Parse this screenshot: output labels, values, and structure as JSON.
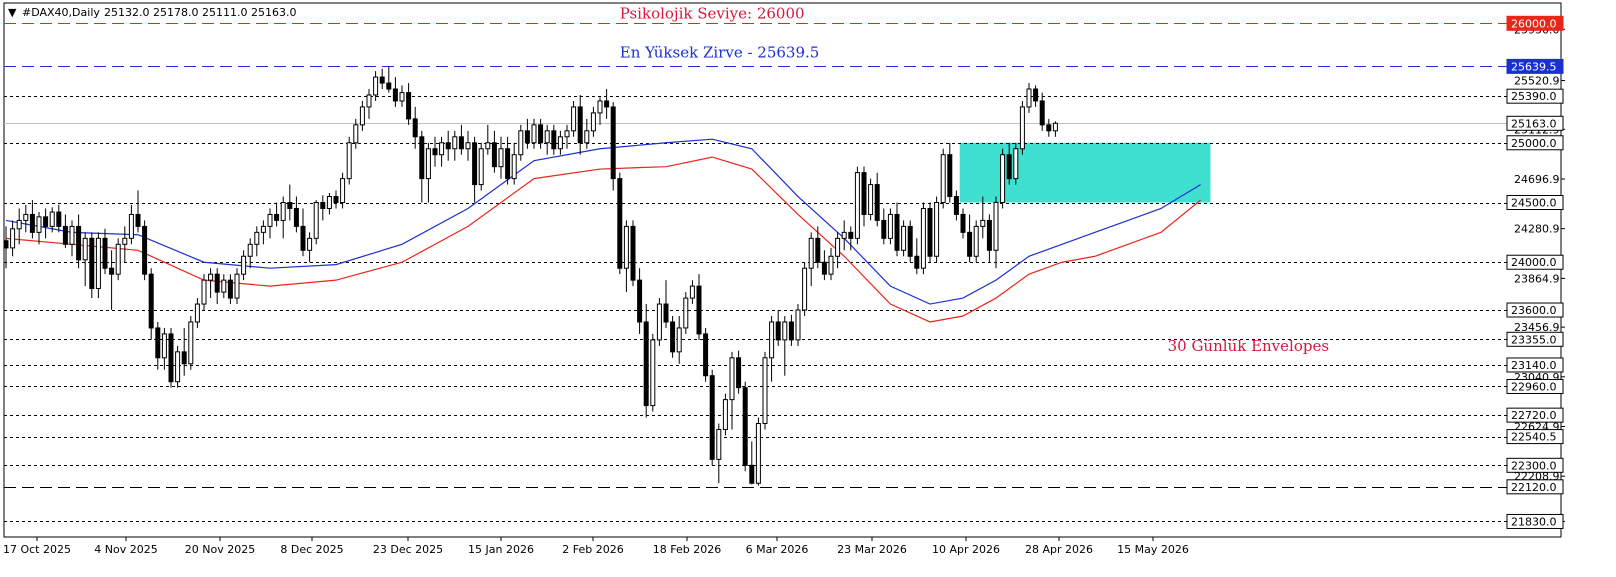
{
  "header": {
    "symbol": "#DAX40,Daily",
    "ohlc": "25132.0 25178.0 25111.0 25163.0",
    "arrow": "▼"
  },
  "colors": {
    "background": "#ffffff",
    "bull_candle": "#ffffff",
    "bear_candle": "#000000",
    "ma_blue": "#1a2fd6",
    "envelope_red": "#e8261a",
    "zone_fill": "#40e0d0",
    "line_26000": "#e8261a",
    "line_25639": "#1a2fd6",
    "annot_red": "#d6163c",
    "annot_blue": "#1a2fd6"
  },
  "chart_data": {
    "type": "candlestick",
    "ylim": [
      21700,
      26170
    ],
    "x_ticks": [
      "17 Oct 2025",
      "4 Nov 2025",
      "20 Nov 2025",
      "8 Dec 2025",
      "23 Dec 2025",
      "15 Jan 2026",
      "2 Feb 2026",
      "18 Feb 2026",
      "6 Mar 2026",
      "23 Mar 2026",
      "10 Apr 2026",
      "28 Apr 2026",
      "15 May 2026"
    ],
    "y_price_labels": [
      "25950.0",
      "25520.9",
      "25112.9",
      "24696.9",
      "24280.9",
      "23864.9",
      "23456.9",
      "23040.9",
      "22624.9",
      "22208.9",
      "21830.0"
    ],
    "levels": [
      {
        "value": 26000,
        "label": "26000.0",
        "style": "long-dash",
        "color": "#e8261a",
        "text_color": "#ffffff",
        "bg": "#e8261a"
      },
      {
        "value": 25639.5,
        "label": "25639.5",
        "style": "long-dash",
        "color": "#1a2fd6",
        "text_color": "#ffffff",
        "bg": "#1a2fd6"
      },
      {
        "value": 25390,
        "label": "25390.0",
        "style": "dotted",
        "color": "#000000",
        "text_color": "#000000",
        "bg": "#ffffff"
      },
      {
        "value": 25163,
        "label": "25163.0",
        "style": "solid",
        "color": "#c0c0c0",
        "text_color": "#000000",
        "bg": "#ffffff"
      },
      {
        "value": 25000,
        "label": "25000.0",
        "style": "dotted",
        "color": "#000000",
        "text_color": "#000000",
        "bg": "#ffffff"
      },
      {
        "value": 24500,
        "label": "24500.0",
        "style": "dotted",
        "color": "#000000",
        "text_color": "#000000",
        "bg": "#ffffff"
      },
      {
        "value": 24000,
        "label": "24000.0",
        "style": "dotted",
        "color": "#000000",
        "text_color": "#000000",
        "bg": "#ffffff"
      },
      {
        "value": 23600,
        "label": "23600.0",
        "style": "dotted",
        "color": "#000000",
        "text_color": "#000000",
        "bg": "#ffffff"
      },
      {
        "value": 23355,
        "label": "23355.0",
        "style": "dotted",
        "color": "#000000",
        "text_color": "#000000",
        "bg": "#ffffff"
      },
      {
        "value": 23140,
        "label": "23140.0",
        "style": "dotted",
        "color": "#000000",
        "text_color": "#000000",
        "bg": "#ffffff"
      },
      {
        "value": 22960,
        "label": "22960.0",
        "style": "dotted",
        "color": "#000000",
        "text_color": "#000000",
        "bg": "#ffffff"
      },
      {
        "value": 22720,
        "label": "22720.0",
        "style": "dotted",
        "color": "#000000",
        "text_color": "#000000",
        "bg": "#ffffff"
      },
      {
        "value": 22540.5,
        "label": "22540.5",
        "style": "dotted",
        "color": "#000000",
        "text_color": "#000000",
        "bg": "#ffffff"
      },
      {
        "value": 22300,
        "label": "22300.0",
        "style": "dotted",
        "color": "#000000",
        "text_color": "#000000",
        "bg": "#ffffff"
      },
      {
        "value": 22120,
        "label": "22120.0",
        "style": "long-dash",
        "color": "#000000",
        "text_color": "#000000",
        "bg": "#ffffff"
      },
      {
        "value": 21830,
        "label": "21830.0",
        "style": "dotted",
        "color": "#000000",
        "text_color": "#000000",
        "bg": "#ffffff"
      }
    ],
    "annotations": [
      {
        "text": "Psikolojik Seviye: 26000",
        "price": 26040,
        "bar": 93,
        "color": "#d6163c"
      },
      {
        "text": "En Yüksek Zirve - 25639.5",
        "price": 25715,
        "bar": 93,
        "color": "#1a2fd6"
      },
      {
        "text": "30 Günlük Envelopes",
        "price": 23255,
        "bar": 176,
        "color": "#d6163c"
      }
    ],
    "zone": {
      "price_top": 25000,
      "price_bottom": 24500,
      "bar_start": 144.5,
      "bar_end": 182.5
    },
    "candles": [
      [
        24180,
        24300,
        23950,
        24120
      ],
      [
        24120,
        24350,
        24050,
        24280
      ],
      [
        24280,
        24450,
        24150,
        24350
      ],
      [
        24350,
        24480,
        24250,
        24400
      ],
      [
        24400,
        24520,
        24200,
        24250
      ],
      [
        24250,
        24420,
        24150,
        24380
      ],
      [
        24380,
        24450,
        24200,
        24300
      ],
      [
        24300,
        24460,
        24250,
        24420
      ],
      [
        24420,
        24480,
        24250,
        24300
      ],
      [
        24300,
        24400,
        24120,
        24150
      ],
      [
        24150,
        24350,
        24050,
        24300
      ],
      [
        24300,
        24400,
        23950,
        24020
      ],
      [
        24020,
        24250,
        23800,
        24200
      ],
      [
        24200,
        24250,
        23700,
        23780
      ],
      [
        23780,
        24250,
        23700,
        24200
      ],
      [
        24200,
        24280,
        23900,
        23950
      ],
      [
        23950,
        24100,
        23600,
        23900
      ],
      [
        23900,
        24200,
        23850,
        24150
      ],
      [
        24150,
        24300,
        24000,
        24200
      ],
      [
        24200,
        24480,
        24150,
        24400
      ],
      [
        24400,
        24600,
        24250,
        24300
      ],
      [
        24300,
        24350,
        23850,
        23900
      ],
      [
        23900,
        23950,
        23350,
        23450
      ],
      [
        23450,
        23500,
        23100,
        23200
      ],
      [
        23200,
        23450,
        23100,
        23400
      ],
      [
        23400,
        23450,
        22950,
        23000
      ],
      [
        23000,
        23300,
        22950,
        23250
      ],
      [
        23250,
        23450,
        23050,
        23150
      ],
      [
        23150,
        23550,
        23100,
        23500
      ],
      [
        23500,
        23700,
        23450,
        23650
      ],
      [
        23650,
        23900,
        23600,
        23850
      ],
      [
        23850,
        23950,
        23700,
        23900
      ],
      [
        23900,
        23950,
        23650,
        23750
      ],
      [
        23750,
        23900,
        23700,
        23850
      ],
      [
        23850,
        23900,
        23650,
        23700
      ],
      [
        23700,
        23950,
        23650,
        23900
      ],
      [
        23900,
        24100,
        23850,
        24050
      ],
      [
        24050,
        24200,
        23950,
        24150
      ],
      [
        24150,
        24300,
        24050,
        24250
      ],
      [
        24250,
        24350,
        24150,
        24300
      ],
      [
        24300,
        24450,
        24200,
        24400
      ],
      [
        24400,
        24500,
        24300,
        24350
      ],
      [
        24350,
        24550,
        24200,
        24500
      ],
      [
        24500,
        24650,
        24350,
        24450
      ],
      [
        24450,
        24550,
        24250,
        24300
      ],
      [
        24300,
        24450,
        24050,
        24100
      ],
      [
        24100,
        24250,
        24000,
        24200
      ],
      [
        24200,
        24520,
        24150,
        24500
      ],
      [
        24500,
        24560,
        24350,
        24450
      ],
      [
        24450,
        24580,
        24400,
        24550
      ],
      [
        24550,
        24600,
        24450,
        24500
      ],
      [
        24500,
        24750,
        24450,
        24700
      ],
      [
        24700,
        25050,
        24650,
        25000
      ],
      [
        25000,
        25200,
        24950,
        25150
      ],
      [
        25150,
        25350,
        25100,
        25300
      ],
      [
        25300,
        25450,
        25200,
        25400
      ],
      [
        25400,
        25600,
        25350,
        25550
      ],
      [
        25550,
        25620,
        25450,
        25500
      ],
      [
        25500,
        25640,
        25420,
        25450
      ],
      [
        25450,
        25550,
        25300,
        25350
      ],
      [
        25350,
        25480,
        25300,
        25420
      ],
      [
        25420,
        25500,
        25150,
        25200
      ],
      [
        25200,
        25300,
        24950,
        25050
      ],
      [
        25050,
        25100,
        24500,
        24700
      ],
      [
        24700,
        25000,
        24500,
        24950
      ],
      [
        24950,
        25050,
        24800,
        24900
      ],
      [
        24900,
        25050,
        24800,
        25000
      ],
      [
        25000,
        25100,
        24850,
        24950
      ],
      [
        24950,
        25100,
        24850,
        25050
      ],
      [
        25050,
        25150,
        24900,
        24950
      ],
      [
        24950,
        25100,
        24850,
        25000
      ],
      [
        25000,
        25050,
        24500,
        24650
      ],
      [
        24650,
        25000,
        24600,
        24950
      ],
      [
        24950,
        25150,
        24900,
        25000
      ],
      [
        25000,
        25100,
        24750,
        24800
      ],
      [
        24800,
        25050,
        24700,
        24950
      ],
      [
        24950,
        25050,
        24650,
        24700
      ],
      [
        24700,
        25000,
        24650,
        24900
      ],
      [
        24900,
        25150,
        24850,
        25100
      ],
      [
        25100,
        25200,
        24950,
        25000
      ],
      [
        25000,
        25200,
        24950,
        25150
      ],
      [
        25150,
        25200,
        24950,
        25000
      ],
      [
        25000,
        25150,
        24900,
        25100
      ],
      [
        25100,
        25150,
        24900,
        24950
      ],
      [
        24950,
        25100,
        24900,
        25050
      ],
      [
        25050,
        25150,
        24950,
        25100
      ],
      [
        25100,
        25350,
        25050,
        25300
      ],
      [
        25300,
        25400,
        24900,
        25000
      ],
      [
        25000,
        25200,
        24950,
        25100
      ],
      [
        25100,
        25300,
        25050,
        25250
      ],
      [
        25250,
        25380,
        25150,
        25350
      ],
      [
        25350,
        25450,
        25200,
        25300
      ],
      [
        25300,
        25340,
        24600,
        24700
      ],
      [
        24700,
        24750,
        23900,
        23950
      ],
      [
        23950,
        24350,
        23750,
        24300
      ],
      [
        24300,
        24350,
        23800,
        23850
      ],
      [
        23850,
        23950,
        23400,
        23500
      ],
      [
        23500,
        23650,
        22700,
        22800
      ],
      [
        22800,
        23400,
        22750,
        23350
      ],
      [
        23350,
        23700,
        23300,
        23650
      ],
      [
        23650,
        23850,
        23450,
        23500
      ],
      [
        23500,
        23550,
        23200,
        23250
      ],
      [
        23250,
        23550,
        23150,
        23450
      ],
      [
        23450,
        23750,
        23400,
        23700
      ],
      [
        23700,
        23850,
        23650,
        23800
      ],
      [
        23800,
        23900,
        23350,
        23400
      ],
      [
        23400,
        23450,
        23000,
        23050
      ],
      [
        23050,
        23100,
        22300,
        22350
      ],
      [
        22350,
        22650,
        22150,
        22600
      ],
      [
        22600,
        22900,
        22550,
        22850
      ],
      [
        22850,
        23250,
        22600,
        23200
      ],
      [
        23200,
        23260,
        22900,
        22950
      ],
      [
        22950,
        23000,
        22250,
        22300
      ],
      [
        22300,
        22500,
        22140,
        22150
      ],
      [
        22150,
        22700,
        22130,
        22650
      ],
      [
        22650,
        23250,
        22600,
        23200
      ],
      [
        23200,
        23550,
        23000,
        23500
      ],
      [
        23500,
        23600,
        23300,
        23350
      ],
      [
        23350,
        23550,
        23050,
        23500
      ],
      [
        23500,
        23560,
        23300,
        23350
      ],
      [
        23350,
        23650,
        23300,
        23600
      ],
      [
        23600,
        24000,
        23550,
        23950
      ],
      [
        23950,
        24250,
        23800,
        24200
      ],
      [
        24200,
        24300,
        23950,
        24000
      ],
      [
        24000,
        24100,
        23850,
        23900
      ],
      [
        23900,
        24120,
        23850,
        24050
      ],
      [
        24050,
        24250,
        23950,
        24200
      ],
      [
        24200,
        24350,
        24100,
        24250
      ],
      [
        24250,
        24300,
        24100,
        24200
      ],
      [
        24200,
        24800,
        24150,
        24750
      ],
      [
        24750,
        24800,
        24300,
        24400
      ],
      [
        24400,
        24700,
        24350,
        24650
      ],
      [
        24650,
        24750,
        24300,
        24350
      ],
      [
        24350,
        24450,
        24150,
        24200
      ],
      [
        24200,
        24450,
        24150,
        24400
      ],
      [
        24400,
        24500,
        24050,
        24100
      ],
      [
        24100,
        24350,
        24050,
        24300
      ],
      [
        24300,
        24350,
        24000,
        24050
      ],
      [
        24050,
        24200,
        23900,
        23950
      ],
      [
        23950,
        24500,
        23900,
        24450
      ],
      [
        24450,
        24500,
        24000,
        24050
      ],
      [
        24050,
        24550,
        24000,
        24500
      ],
      [
        24500,
        24950,
        24450,
        24900
      ],
      [
        24900,
        25000,
        24500,
        24550
      ],
      [
        24550,
        24600,
        24350,
        24400
      ],
      [
        24400,
        24450,
        24200,
        24250
      ],
      [
        24250,
        24400,
        24000,
        24050
      ],
      [
        24050,
        24350,
        24000,
        24300
      ],
      [
        24300,
        24550,
        24200,
        24350
      ],
      [
        24350,
        24400,
        24000,
        24100
      ],
      [
        24100,
        24550,
        23950,
        24500
      ],
      [
        24500,
        24950,
        24450,
        24900
      ],
      [
        24900,
        25000,
        24650,
        24700
      ],
      [
        24700,
        25000,
        24650,
        24950
      ],
      [
        24950,
        25350,
        24900,
        25300
      ],
      [
        25300,
        25500,
        25250,
        25450
      ],
      [
        25450,
        25480,
        25300,
        25350
      ],
      [
        25350,
        25420,
        25100,
        25150
      ],
      [
        25150,
        25200,
        25050,
        25100
      ],
      [
        25100,
        25180,
        25050,
        25163
      ]
    ],
    "ma_blue": [
      [
        0,
        24350
      ],
      [
        10,
        24250
      ],
      [
        20,
        24230
      ],
      [
        30,
        24000
      ],
      [
        40,
        23950
      ],
      [
        50,
        23980
      ],
      [
        60,
        24150
      ],
      [
        70,
        24450
      ],
      [
        80,
        24850
      ],
      [
        90,
        24950
      ],
      [
        100,
        25000
      ],
      [
        107,
        25030
      ],
      [
        113,
        24950
      ],
      [
        120,
        24550
      ],
      [
        127,
        24200
      ],
      [
        134,
        23800
      ],
      [
        140,
        23650
      ],
      [
        145,
        23700
      ],
      [
        150,
        23850
      ],
      [
        155,
        24050
      ],
      [
        160,
        24150
      ],
      [
        165,
        24250
      ],
      [
        170,
        24350
      ],
      [
        175,
        24450
      ],
      [
        181,
        24650
      ]
    ],
    "envelope_red": [
      [
        0,
        24200
      ],
      [
        10,
        24150
      ],
      [
        20,
        24100
      ],
      [
        30,
        23850
      ],
      [
        40,
        23800
      ],
      [
        50,
        23850
      ],
      [
        60,
        24000
      ],
      [
        70,
        24300
      ],
      [
        80,
        24700
      ],
      [
        90,
        24780
      ],
      [
        100,
        24800
      ],
      [
        107,
        24880
      ],
      [
        113,
        24780
      ],
      [
        120,
        24400
      ],
      [
        127,
        24050
      ],
      [
        134,
        23650
      ],
      [
        140,
        23500
      ],
      [
        145,
        23550
      ],
      [
        150,
        23700
      ],
      [
        155,
        23900
      ],
      [
        160,
        24000
      ],
      [
        165,
        24050
      ],
      [
        170,
        24150
      ],
      [
        175,
        24250
      ],
      [
        181,
        24520
      ]
    ]
  }
}
